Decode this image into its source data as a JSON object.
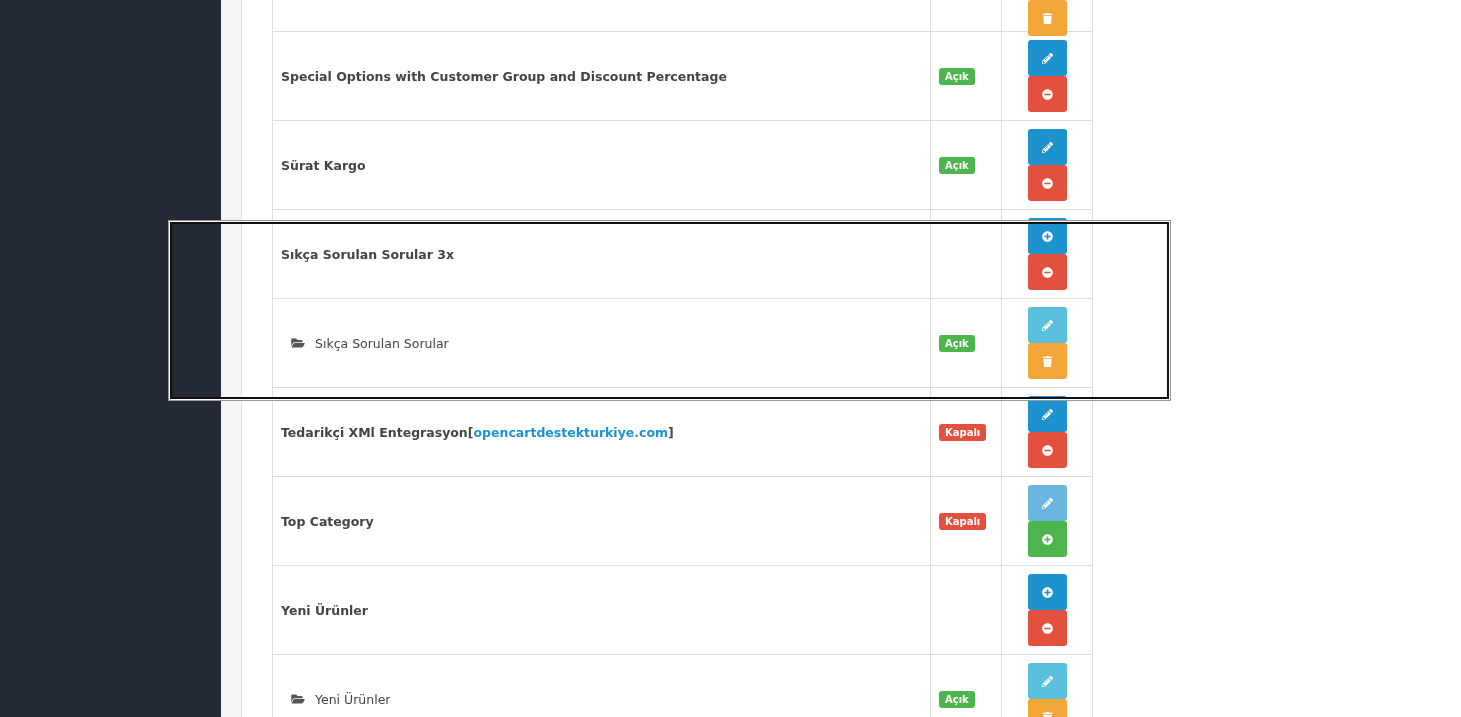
{
  "selection_frame": {
    "visible": true
  },
  "rows": [
    {
      "kind": "cut",
      "buttons": [
        {
          "kind": "delete",
          "disabled": false
        }
      ]
    },
    {
      "kind": "parent",
      "name": {
        "text": "Special Options with Customer Group and Discount Percentage"
      },
      "status": {
        "label": "Açık",
        "kind": "on"
      },
      "buttons": [
        {
          "kind": "edit",
          "disabled": false
        },
        {
          "kind": "uninstall",
          "disabled": false
        }
      ]
    },
    {
      "kind": "parent",
      "name": {
        "text": "Sürat Kargo"
      },
      "status": {
        "label": "Açık",
        "kind": "on"
      },
      "buttons": [
        {
          "kind": "edit",
          "disabled": false
        },
        {
          "kind": "uninstall",
          "disabled": false
        }
      ]
    },
    {
      "kind": "parent",
      "name": {
        "text": "Sıkça Sorulan Sorular 3x"
      },
      "buttons": [
        {
          "kind": "add",
          "disabled": false
        },
        {
          "kind": "uninstall",
          "disabled": false
        }
      ]
    },
    {
      "kind": "child",
      "name": {
        "text": "Sıkça Sorulan Sorular"
      },
      "status": {
        "label": "Açık",
        "kind": "on"
      },
      "buttons": [
        {
          "kind": "edit",
          "disabled": false
        },
        {
          "kind": "delete",
          "disabled": false
        }
      ]
    },
    {
      "kind": "parent",
      "name": {
        "text": "Tedarikçi XMl Entegrasyon[",
        "link": "opencartdestekturkiye.com",
        "suffix": "]"
      },
      "status": {
        "label": "Kapalı",
        "kind": "off"
      },
      "buttons": [
        {
          "kind": "edit",
          "disabled": false
        },
        {
          "kind": "uninstall",
          "disabled": false
        }
      ]
    },
    {
      "kind": "parent",
      "name": {
        "text": "Top Category"
      },
      "status": {
        "label": "Kapalı",
        "kind": "off"
      },
      "buttons": [
        {
          "kind": "edit",
          "disabled": true
        },
        {
          "kind": "install",
          "disabled": false
        }
      ]
    },
    {
      "kind": "parent",
      "name": {
        "text": "Yeni Ürünler"
      },
      "buttons": [
        {
          "kind": "add",
          "disabled": false
        },
        {
          "kind": "uninstall",
          "disabled": false
        }
      ]
    },
    {
      "kind": "child",
      "name": {
        "text": "Yeni Ürünler"
      },
      "status": {
        "label": "Açık",
        "kind": "on"
      },
      "buttons": [
        {
          "kind": "edit",
          "disabled": false
        },
        {
          "kind": "delete",
          "disabled": false
        }
      ]
    }
  ]
}
